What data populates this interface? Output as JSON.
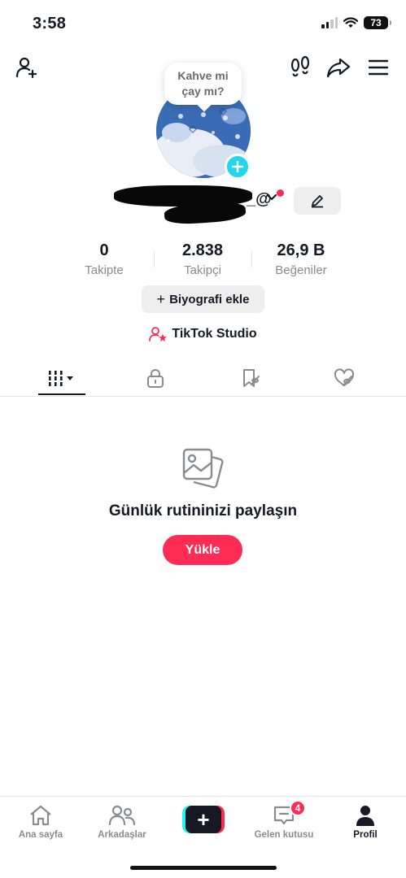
{
  "status_bar": {
    "time": "3:58",
    "battery": "73"
  },
  "profile": {
    "bubble_text": "Kahve mi\nçay mı?",
    "username_suffix": "_@",
    "stats": [
      {
        "value": "0",
        "label": "Takipte"
      },
      {
        "value": "2.838",
        "label": "Takipçi"
      },
      {
        "value": "26,9 B",
        "label": "Beğeniler"
      }
    ],
    "bio_button": {
      "plus": "+",
      "label": "Biyografi ekle"
    },
    "studio_label": "TikTok Studio"
  },
  "tabs": [
    {
      "icon": "grid-icon"
    },
    {
      "icon": "lock-icon"
    },
    {
      "icon": "bookmark-icon"
    },
    {
      "icon": "liked-icon"
    }
  ],
  "empty_state": {
    "icon": "photos-icon",
    "title": "Günlük rutininizi paylaşın",
    "button": "Yükle"
  },
  "bottom_nav": {
    "home": "Ana sayfa",
    "friends": "Arkadaşlar",
    "create": "+",
    "inbox": "Gelen kutusu",
    "inbox_badge": "4",
    "profile": "Profil"
  },
  "colors": {
    "accent": "#fe2c55",
    "cyan": "#20d5ec",
    "text": "#161823",
    "muted": "#8a8b91"
  }
}
